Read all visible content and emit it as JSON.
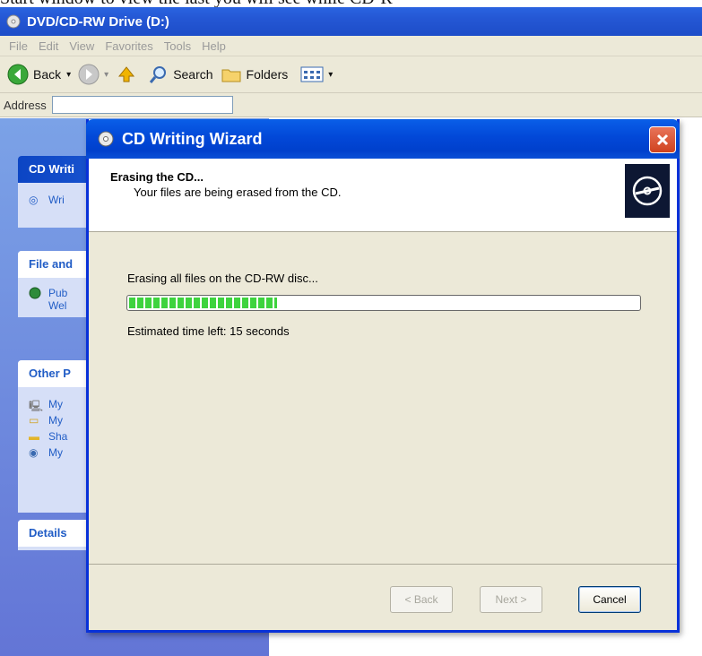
{
  "caption": "Start window to view the last you will see while CD-R",
  "explorer": {
    "title": "DVD/CD-RW Drive (D:)",
    "menu": [
      "File",
      "Edit",
      "View",
      "Favorites",
      "Tools",
      "Help"
    ],
    "toolbar": {
      "back": "Back",
      "search": "Search",
      "folders": "Folders"
    },
    "address_label": "Address"
  },
  "taskpane": {
    "cd_tasks": {
      "title": "CD Writi",
      "items": [
        "Wri"
      ]
    },
    "file_folder": {
      "title": "File and",
      "items": [
        "Pub",
        "Wel"
      ]
    },
    "other_places": {
      "title": "Other P",
      "items": [
        "My",
        "My",
        "Sha",
        "My"
      ]
    },
    "details": {
      "title": "Details"
    }
  },
  "wizard": {
    "title": "CD Writing Wizard",
    "header_title": "Erasing the CD...",
    "header_subtitle": "Your files are being erased from the CD.",
    "status": "Erasing all files on the CD-RW disc...",
    "progress_percent": 29,
    "time_left": "Estimated time left: 15 seconds",
    "buttons": {
      "back": "< Back",
      "next": "Next >",
      "cancel": "Cancel"
    }
  },
  "colors": {
    "title_blue": "#0248d8",
    "progress_green": "#3ed33e",
    "dialog_bg": "#ece9d8",
    "taskpane_blue": "#6f8edd"
  }
}
